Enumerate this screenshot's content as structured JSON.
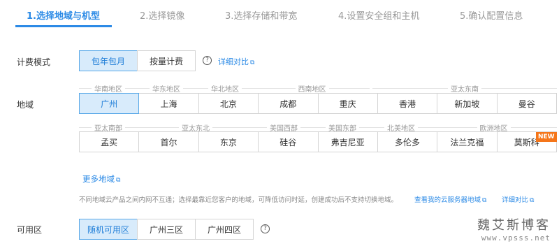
{
  "steps": [
    {
      "label": "1.选择地域与机型"
    },
    {
      "label": "2.选择镜像"
    },
    {
      "label": "3.选择存储和带宽"
    },
    {
      "label": "4.设置安全组和主机"
    },
    {
      "label": "5.确认配置信息"
    }
  ],
  "billing": {
    "label": "计费模式",
    "options": [
      "包年包月",
      "按量计费"
    ],
    "selected": "包年包月",
    "help": "?",
    "compare_link": "详细对比"
  },
  "region": {
    "label": "地域",
    "row1_groups": [
      "华南地区",
      "华东地区",
      "华北地区",
      "西南地区",
      "亚太东南"
    ],
    "row1_cells": [
      "广州",
      "上海",
      "北京",
      "成都",
      "重庆",
      "香港",
      "新加坡",
      "曼谷"
    ],
    "selected": "广州",
    "row2_groups": [
      "亚太南部",
      "亚太东北",
      "美国西部",
      "美国东部",
      "北美地区",
      "欧洲地区"
    ],
    "row2_cells": [
      "孟买",
      "首尔",
      "东京",
      "硅谷",
      "弗吉尼亚",
      "多伦多",
      "法兰克福",
      "莫斯科"
    ],
    "new_badge": "NEW",
    "more_link": "更多地域",
    "note": "不同地域云产品之间内网不互通；选择最靠近您客户的地域，可降低访问时延，创建成功后不支持切换地域。",
    "servers_link": "查看我的云服务器地域",
    "compare_link": "详细对比"
  },
  "zone": {
    "label": "可用区",
    "options": [
      "随机可用区",
      "广州三区",
      "广州四区"
    ],
    "selected": "随机可用区",
    "help": "?"
  },
  "watermark": {
    "title": "魏艾斯博客",
    "url": "www.vpsss.net"
  },
  "colors": {
    "accent": "#2b8ae6",
    "selected_bg": "#d8ebfb",
    "new_badge": "#f5761a"
  }
}
